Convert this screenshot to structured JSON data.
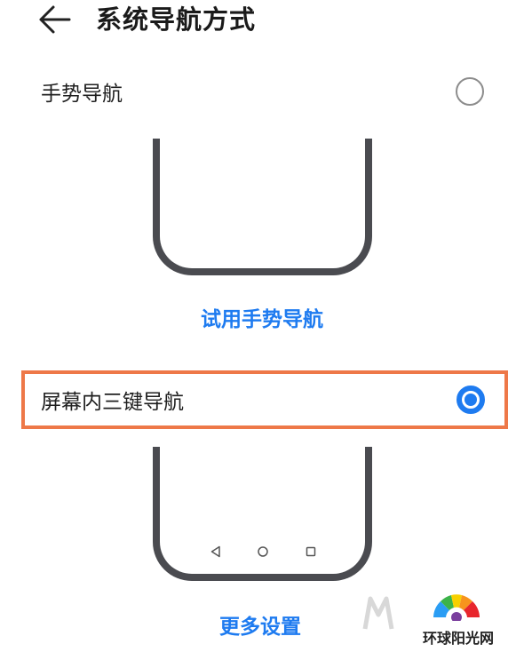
{
  "header": {
    "title": "系统导航方式"
  },
  "options": {
    "gesture": {
      "label": "手势导航",
      "selected": false
    },
    "three_key": {
      "label": "屏幕内三键导航",
      "selected": true
    }
  },
  "links": {
    "try_gesture": "试用手势导航",
    "more_settings": "更多设置"
  },
  "watermark": {
    "site_name": "环球阳光网"
  },
  "colors": {
    "accent": "#1e7bf0",
    "highlight_border": "#ee7848",
    "phone_frame": "#4a4b50"
  },
  "icons": {
    "back": "back-arrow-icon",
    "nav_back": "triangle-back-icon",
    "nav_home": "circle-home-icon",
    "nav_recent": "square-recent-icon"
  }
}
